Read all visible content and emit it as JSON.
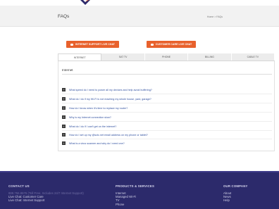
{
  "header": {
    "page_title": "FAQs",
    "breadcrumb": "Home > FAQs"
  },
  "actions": {
    "internet_support": "INTERNET SUPPORT LIVE CHAT",
    "customer_care": "CUSTOMER CARE LIVE CHAT"
  },
  "tabs": [
    {
      "label": "INTERNET",
      "active": true
    },
    {
      "label": "SAT TV",
      "active": false
    },
    {
      "label": "PHONE",
      "active": false
    },
    {
      "label": "BILLING",
      "active": false
    },
    {
      "label": "CABLE TV",
      "active": false
    }
  ],
  "category": "Internet",
  "faqs": [
    "What speed do I need to power all my devices and help avoid buffering?",
    "What do I do if my Wi-Fi is not reaching my whole house, yard, garage?",
    "How do I know when it's time to replace my router?",
    "Why is my Internet connection slow?",
    "What do I do if I can't get on the internet?",
    "How do I set up my @sctc.net email address on my phone or tablet?",
    "What is a virus scanner and why do I need one?"
  ],
  "footer": {
    "contact": {
      "heading": "CONTACT US",
      "phone": "888.756.8676 (Toll Free, Includes 24/7 Internet Support)",
      "link1": "Live Chat: Customer Care",
      "link2": "Live Chat: Internet Support"
    },
    "products": {
      "heading": "PRODUCTS & SERVICES",
      "items": [
        "Internet",
        "Managed Wi-Fi",
        "TV",
        "Phone"
      ]
    },
    "company": {
      "heading": "OUR COMPANY",
      "items": [
        "About",
        "News",
        "Help"
      ]
    }
  },
  "colors": {
    "accent_orange": "#e8612c",
    "footer_navy": "#2c2a6b",
    "link_blue": "#2f4f9f"
  }
}
